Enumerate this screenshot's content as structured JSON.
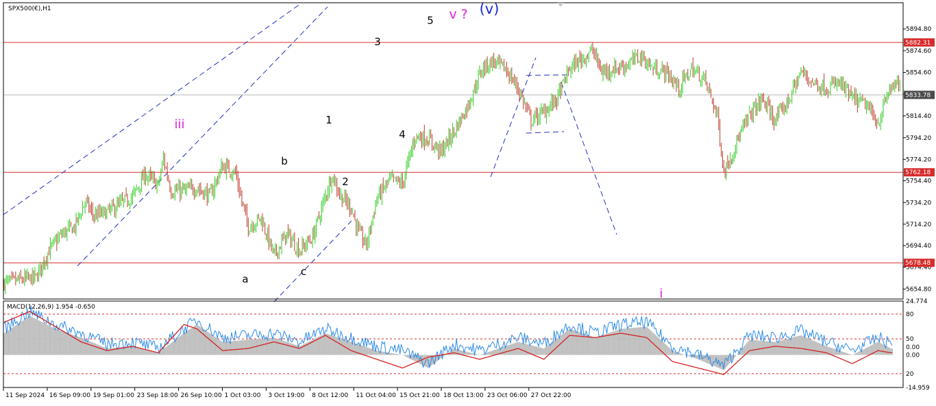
{
  "colors": {
    "bull": "#2ecc1f",
    "bear": "#c0392b",
    "hline": "#d62b2b",
    "trend": "#1f2fbf",
    "macd_line": "#2b8be6",
    "signal_line": "#d42020",
    "histogram": "#bfbfbf",
    "label_magenta": "#e020e0",
    "label_blue": "#1a2bd6",
    "price_label_bg": "#d62b2b",
    "current_label_bg": "#4a4a4a"
  },
  "chart_data": [
    {
      "type": "candlestick",
      "title": "SPX500(€),H1",
      "ylim": [
        5645,
        5919
      ],
      "y_ticks": [
        5894.8,
        5874.6,
        5854.6,
        5834.4,
        5814.4,
        5794.2,
        5774.2,
        5754.4,
        5734.2,
        5714.2,
        5694.4,
        5674.4,
        5654.2
      ],
      "y_tick_labels": [
        "5894.80",
        "5874.60",
        "5854.60",
        "5834.40",
        "5814.40",
        "5794.20",
        "5774.20",
        "5754.40",
        "5734.20",
        "5714.20",
        "5694.40",
        "5674.40",
        "5654.80"
      ],
      "x_tick_labels": [
        "11 Sep 2024",
        "16 Sep 09:00",
        "19 Sep 01:00",
        "23 Sep 18:00",
        "26 Sep 10:00",
        "1 Oct 03:00",
        "3 Oct 19:00",
        "8 Oct 12:00",
        "11 Oct 04:00",
        "15 Oct 21:00",
        "18 Oct 13:00",
        "23 Oct 06:00",
        "27 Oct 22:00"
      ],
      "close_path": [
        [
          0,
          5660
        ],
        [
          25,
          5665
        ],
        [
          35,
          5690
        ],
        [
          45,
          5705
        ],
        [
          55,
          5712
        ],
        [
          63,
          5735
        ],
        [
          70,
          5722
        ],
        [
          80,
          5725
        ],
        [
          100,
          5740
        ],
        [
          110,
          5760
        ],
        [
          120,
          5750
        ],
        [
          124,
          5775
        ],
        [
          130,
          5745
        ],
        [
          140,
          5745
        ],
        [
          150,
          5748
        ],
        [
          160,
          5740
        ],
        [
          170,
          5768
        ],
        [
          180,
          5762
        ],
        [
          185,
          5735
        ],
        [
          190,
          5712
        ],
        [
          200,
          5720
        ],
        [
          210,
          5685
        ],
        [
          220,
          5705
        ],
        [
          230,
          5690
        ],
        [
          240,
          5702
        ],
        [
          250,
          5740
        ],
        [
          255,
          5760
        ],
        [
          262,
          5740
        ],
        [
          270,
          5730
        ],
        [
          276,
          5706
        ],
        [
          282,
          5695
        ],
        [
          290,
          5738
        ],
        [
          300,
          5755
        ],
        [
          310,
          5752
        ],
        [
          320,
          5796
        ],
        [
          330,
          5793
        ],
        [
          340,
          5781
        ],
        [
          350,
          5800
        ],
        [
          360,
          5822
        ],
        [
          372,
          5858
        ],
        [
          380,
          5865
        ],
        [
          390,
          5858
        ],
        [
          400,
          5840
        ],
        [
          410,
          5810
        ],
        [
          420,
          5818
        ],
        [
          430,
          5830
        ],
        [
          440,
          5858
        ],
        [
          450,
          5868
        ],
        [
          458,
          5875
        ],
        [
          465,
          5855
        ],
        [
          475,
          5858
        ],
        [
          485,
          5862
        ],
        [
          495,
          5870
        ],
        [
          505,
          5858
        ],
        [
          515,
          5855
        ],
        [
          525,
          5840
        ],
        [
          535,
          5858
        ],
        [
          545,
          5848
        ],
        [
          555,
          5815
        ],
        [
          560,
          5762
        ],
        [
          570,
          5790
        ],
        [
          580,
          5815
        ],
        [
          590,
          5830
        ],
        [
          600,
          5810
        ],
        [
          610,
          5828
        ],
        [
          620,
          5855
        ],
        [
          630,
          5845
        ],
        [
          640,
          5840
        ],
        [
          650,
          5845
        ],
        [
          660,
          5830
        ],
        [
          670,
          5825
        ],
        [
          680,
          5808
        ],
        [
          690,
          5842
        ]
      ],
      "hlines": [
        {
          "price": 5882.31,
          "label": "5882.31"
        },
        {
          "price": 5762.18,
          "label": "5762.18"
        },
        {
          "price": 5678.48,
          "label": "5678.48"
        }
      ],
      "current_price": {
        "price": 5833.78,
        "label": "5833.78"
      },
      "wave_labels": [
        {
          "text": "iii",
          "color": "magenta"
        },
        {
          "text": "a",
          "color": "black"
        },
        {
          "text": "b",
          "color": "black"
        },
        {
          "text": "c",
          "color": "black"
        },
        {
          "text": "1",
          "color": "black"
        },
        {
          "text": "2",
          "color": "black"
        },
        {
          "text": "3",
          "color": "black"
        },
        {
          "text": "4",
          "color": "black"
        },
        {
          "text": "5",
          "color": "black"
        },
        {
          "text": "v ?",
          "color": "magenta"
        },
        {
          "text": "(v)",
          "color": "blue"
        },
        {
          "text": "i",
          "color": "magenta"
        }
      ]
    },
    {
      "type": "line",
      "title": "MACD(12,26,9) 1.954 -0.650",
      "ylim": [
        -14.959,
        24.774
      ],
      "y_ticks": [
        24.774,
        18.8,
        7.4,
        3.65,
        0.0,
        -8.6,
        -14.959
      ],
      "y_tick_labels": [
        "24.774",
        "80",
        "50",
        "0.00",
        "0.00",
        "20",
        "-14.959"
      ],
      "levels": [
        18.8,
        7.4,
        -8.6
      ],
      "series": [
        {
          "role": "macd",
          "values": [
            [
              0,
              12
            ],
            [
              20,
              20
            ],
            [
              40,
              14
            ],
            [
              60,
              10
            ],
            [
              80,
              5
            ],
            [
              100,
              6
            ],
            [
              120,
              3
            ],
            [
              140,
              12
            ],
            [
              150,
              16
            ],
            [
              170,
              8
            ],
            [
              190,
              9
            ],
            [
              210,
              10
            ],
            [
              230,
              6
            ],
            [
              250,
              12
            ],
            [
              270,
              8
            ],
            [
              290,
              4
            ],
            [
              310,
              2
            ],
            [
              330,
              -4
            ],
            [
              350,
              5
            ],
            [
              370,
              2
            ],
            [
              400,
              8
            ],
            [
              420,
              5
            ],
            [
              440,
              14
            ],
            [
              460,
              10
            ],
            [
              480,
              14
            ],
            [
              500,
              15
            ],
            [
              520,
              4
            ],
            [
              540,
              0
            ],
            [
              560,
              -5
            ],
            [
              580,
              9
            ],
            [
              600,
              8
            ],
            [
              620,
              11
            ],
            [
              640,
              6
            ],
            [
              660,
              2
            ],
            [
              680,
              8
            ],
            [
              690,
              5
            ]
          ]
        },
        {
          "role": "signal",
          "values": [
            [
              0,
              15
            ],
            [
              20,
              20
            ],
            [
              40,
              13
            ],
            [
              60,
              6
            ],
            [
              80,
              2
            ],
            [
              100,
              4
            ],
            [
              120,
              1
            ],
            [
              140,
              14
            ],
            [
              150,
              12
            ],
            [
              170,
              2
            ],
            [
              190,
              3
            ],
            [
              210,
              6
            ],
            [
              230,
              3
            ],
            [
              250,
              9
            ],
            [
              270,
              2
            ],
            [
              290,
              -2
            ],
            [
              310,
              -6
            ],
            [
              330,
              -1
            ],
            [
              350,
              1
            ],
            [
              370,
              -2
            ],
            [
              400,
              3
            ],
            [
              420,
              -2
            ],
            [
              440,
              9
            ],
            [
              460,
              8
            ],
            [
              480,
              10
            ],
            [
              500,
              8
            ],
            [
              520,
              -3
            ],
            [
              540,
              -6
            ],
            [
              560,
              -9
            ],
            [
              580,
              2
            ],
            [
              600,
              4
            ],
            [
              620,
              3
            ],
            [
              640,
              1
            ],
            [
              660,
              -4
            ],
            [
              680,
              2
            ],
            [
              690,
              1
            ]
          ]
        }
      ]
    }
  ]
}
